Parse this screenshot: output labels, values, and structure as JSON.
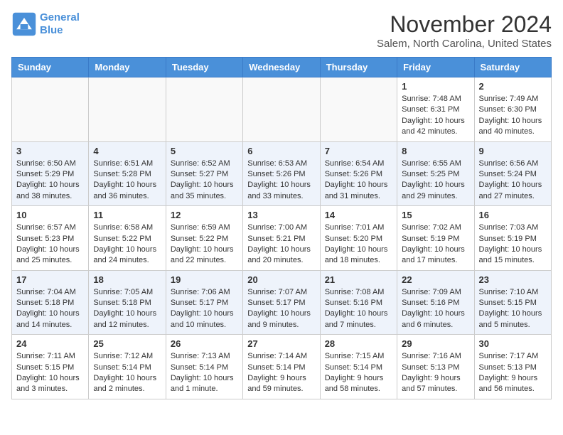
{
  "header": {
    "logo_line1": "General",
    "logo_line2": "Blue",
    "month": "November 2024",
    "location": "Salem, North Carolina, United States"
  },
  "weekdays": [
    "Sunday",
    "Monday",
    "Tuesday",
    "Wednesday",
    "Thursday",
    "Friday",
    "Saturday"
  ],
  "weeks": [
    [
      {
        "day": "",
        "info": ""
      },
      {
        "day": "",
        "info": ""
      },
      {
        "day": "",
        "info": ""
      },
      {
        "day": "",
        "info": ""
      },
      {
        "day": "",
        "info": ""
      },
      {
        "day": "1",
        "info": "Sunrise: 7:48 AM\nSunset: 6:31 PM\nDaylight: 10 hours\nand 42 minutes."
      },
      {
        "day": "2",
        "info": "Sunrise: 7:49 AM\nSunset: 6:30 PM\nDaylight: 10 hours\nand 40 minutes."
      }
    ],
    [
      {
        "day": "3",
        "info": "Sunrise: 6:50 AM\nSunset: 5:29 PM\nDaylight: 10 hours\nand 38 minutes."
      },
      {
        "day": "4",
        "info": "Sunrise: 6:51 AM\nSunset: 5:28 PM\nDaylight: 10 hours\nand 36 minutes."
      },
      {
        "day": "5",
        "info": "Sunrise: 6:52 AM\nSunset: 5:27 PM\nDaylight: 10 hours\nand 35 minutes."
      },
      {
        "day": "6",
        "info": "Sunrise: 6:53 AM\nSunset: 5:26 PM\nDaylight: 10 hours\nand 33 minutes."
      },
      {
        "day": "7",
        "info": "Sunrise: 6:54 AM\nSunset: 5:26 PM\nDaylight: 10 hours\nand 31 minutes."
      },
      {
        "day": "8",
        "info": "Sunrise: 6:55 AM\nSunset: 5:25 PM\nDaylight: 10 hours\nand 29 minutes."
      },
      {
        "day": "9",
        "info": "Sunrise: 6:56 AM\nSunset: 5:24 PM\nDaylight: 10 hours\nand 27 minutes."
      }
    ],
    [
      {
        "day": "10",
        "info": "Sunrise: 6:57 AM\nSunset: 5:23 PM\nDaylight: 10 hours\nand 25 minutes."
      },
      {
        "day": "11",
        "info": "Sunrise: 6:58 AM\nSunset: 5:22 PM\nDaylight: 10 hours\nand 24 minutes."
      },
      {
        "day": "12",
        "info": "Sunrise: 6:59 AM\nSunset: 5:22 PM\nDaylight: 10 hours\nand 22 minutes."
      },
      {
        "day": "13",
        "info": "Sunrise: 7:00 AM\nSunset: 5:21 PM\nDaylight: 10 hours\nand 20 minutes."
      },
      {
        "day": "14",
        "info": "Sunrise: 7:01 AM\nSunset: 5:20 PM\nDaylight: 10 hours\nand 18 minutes."
      },
      {
        "day": "15",
        "info": "Sunrise: 7:02 AM\nSunset: 5:19 PM\nDaylight: 10 hours\nand 17 minutes."
      },
      {
        "day": "16",
        "info": "Sunrise: 7:03 AM\nSunset: 5:19 PM\nDaylight: 10 hours\nand 15 minutes."
      }
    ],
    [
      {
        "day": "17",
        "info": "Sunrise: 7:04 AM\nSunset: 5:18 PM\nDaylight: 10 hours\nand 14 minutes."
      },
      {
        "day": "18",
        "info": "Sunrise: 7:05 AM\nSunset: 5:18 PM\nDaylight: 10 hours\nand 12 minutes."
      },
      {
        "day": "19",
        "info": "Sunrise: 7:06 AM\nSunset: 5:17 PM\nDaylight: 10 hours\nand 10 minutes."
      },
      {
        "day": "20",
        "info": "Sunrise: 7:07 AM\nSunset: 5:17 PM\nDaylight: 10 hours\nand 9 minutes."
      },
      {
        "day": "21",
        "info": "Sunrise: 7:08 AM\nSunset: 5:16 PM\nDaylight: 10 hours\nand 7 minutes."
      },
      {
        "day": "22",
        "info": "Sunrise: 7:09 AM\nSunset: 5:16 PM\nDaylight: 10 hours\nand 6 minutes."
      },
      {
        "day": "23",
        "info": "Sunrise: 7:10 AM\nSunset: 5:15 PM\nDaylight: 10 hours\nand 5 minutes."
      }
    ],
    [
      {
        "day": "24",
        "info": "Sunrise: 7:11 AM\nSunset: 5:15 PM\nDaylight: 10 hours\nand 3 minutes."
      },
      {
        "day": "25",
        "info": "Sunrise: 7:12 AM\nSunset: 5:14 PM\nDaylight: 10 hours\nand 2 minutes."
      },
      {
        "day": "26",
        "info": "Sunrise: 7:13 AM\nSunset: 5:14 PM\nDaylight: 10 hours\nand 1 minute."
      },
      {
        "day": "27",
        "info": "Sunrise: 7:14 AM\nSunset: 5:14 PM\nDaylight: 9 hours\nand 59 minutes."
      },
      {
        "day": "28",
        "info": "Sunrise: 7:15 AM\nSunset: 5:14 PM\nDaylight: 9 hours\nand 58 minutes."
      },
      {
        "day": "29",
        "info": "Sunrise: 7:16 AM\nSunset: 5:13 PM\nDaylight: 9 hours\nand 57 minutes."
      },
      {
        "day": "30",
        "info": "Sunrise: 7:17 AM\nSunset: 5:13 PM\nDaylight: 9 hours\nand 56 minutes."
      }
    ]
  ]
}
